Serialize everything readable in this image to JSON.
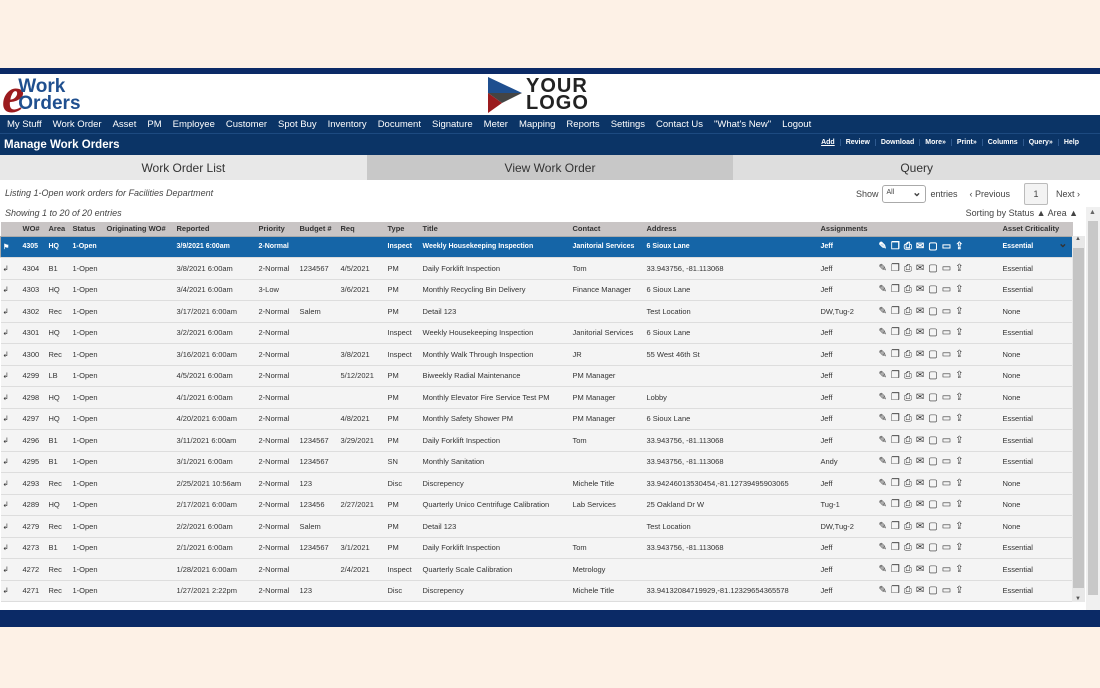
{
  "app": {
    "logo_text": "eWork Orders",
    "brand_logo": "YOUR LOGO",
    "colors": {
      "nav": "#0b3466",
      "selected_row": "#1565a7",
      "logo_red": "#9b1b1e"
    }
  },
  "nav": [
    "My Stuff",
    "Work Order",
    "Asset",
    "PM",
    "Employee",
    "Customer",
    "Spot Buy",
    "Inventory",
    "Document",
    "Signature",
    "Meter",
    "Mapping",
    "Reports",
    "Settings",
    "Contact Us",
    "\"What's New\"",
    "Logout"
  ],
  "title": "Manage Work Orders",
  "toolbar": [
    "Add",
    "Review",
    "Download",
    "More»",
    "Print»",
    "Columns",
    "Query»",
    "Help"
  ],
  "tabs": [
    "Work Order List",
    "View Work Order",
    "Query"
  ],
  "listing": "Listing 1-Open work orders for Facilities Department",
  "showing": "Showing 1 to 20 of 20 entries",
  "pager": {
    "show": "Show",
    "select": "All",
    "entries": "entries",
    "prev": "‹ Previous",
    "page": "1",
    "next": "Next ›"
  },
  "sorting": "Sorting by Status ▲ Area ▲",
  "columns": [
    "",
    "WO#",
    "Area",
    "Status",
    "Originating WO#",
    "Reported",
    "Priority",
    "Budget #",
    "Req",
    "Type",
    "Title",
    "Contact",
    "Address",
    "Assignments",
    "",
    "Asset Criticality"
  ],
  "row_icons": [
    "pencil-icon",
    "copy-icon",
    "print-icon",
    "email-icon",
    "note-icon",
    "comment-icon",
    "upload-icon"
  ],
  "rows": [
    [
      "4305",
      "HQ",
      "1-Open",
      "",
      "3/9/2021 6:00am",
      "2-Normal",
      "",
      "",
      "Inspect",
      "Weekly Housekeeping Inspection",
      "Janitorial Services",
      "6 Sioux Lane",
      "Jeff",
      "Essential"
    ],
    [
      "4304",
      "B1",
      "1-Open",
      "",
      "3/8/2021 6:00am",
      "2-Normal",
      "1234567",
      "4/5/2021",
      "PM",
      "Daily Forklift Inspection",
      "Tom",
      "33.943756, -81.113068",
      "Jeff",
      "Essential"
    ],
    [
      "4303",
      "HQ",
      "1-Open",
      "",
      "3/4/2021 6:00am",
      "3-Low",
      "",
      "3/6/2021",
      "PM",
      "Monthly Recycling Bin Delivery",
      "Finance Manager",
      "6 Sioux Lane",
      "Jeff",
      "Essential"
    ],
    [
      "4302",
      "Rec",
      "1-Open",
      "",
      "3/17/2021 6:00am",
      "2-Normal",
      "Salem",
      "",
      "PM",
      "Detail 123",
      "",
      "Test Location",
      "DW,Tug-2",
      "None"
    ],
    [
      "4301",
      "HQ",
      "1-Open",
      "",
      "3/2/2021 6:00am",
      "2-Normal",
      "",
      "",
      "Inspect",
      "Weekly Housekeeping Inspection",
      "Janitorial Services",
      "6 Sioux Lane",
      "Jeff",
      "Essential"
    ],
    [
      "4300",
      "Rec",
      "1-Open",
      "",
      "3/16/2021 6:00am",
      "2-Normal",
      "",
      "3/8/2021",
      "Inspect",
      "Monthly Walk Through Inspection",
      "JR",
      "55 West 46th St",
      "Jeff",
      "None"
    ],
    [
      "4299",
      "LB",
      "1-Open",
      "",
      "4/5/2021 6:00am",
      "2-Normal",
      "",
      "5/12/2021",
      "PM",
      "Biweekly Radial Maintenance",
      "PM Manager",
      "",
      "Jeff",
      "None"
    ],
    [
      "4298",
      "HQ",
      "1-Open",
      "",
      "4/1/2021 6:00am",
      "2-Normal",
      "",
      "",
      "PM",
      "Monthly Elevator Fire Service Test PM",
      "PM Manager",
      "Lobby",
      "Jeff",
      "None"
    ],
    [
      "4297",
      "HQ",
      "1-Open",
      "",
      "4/20/2021 6:00am",
      "2-Normal",
      "",
      "4/8/2021",
      "PM",
      "Monthly Safety Shower PM",
      "PM Manager",
      "6 Sioux Lane",
      "Jeff",
      "Essential"
    ],
    [
      "4296",
      "B1",
      "1-Open",
      "",
      "3/11/2021 6:00am",
      "2-Normal",
      "1234567",
      "3/29/2021",
      "PM",
      "Daily Forklift Inspection",
      "Tom",
      "33.943756, -81.113068",
      "Jeff",
      "Essential"
    ],
    [
      "4295",
      "B1",
      "1-Open",
      "",
      "3/1/2021 6:00am",
      "2-Normal",
      "1234567",
      "",
      "SN",
      "Monthly Sanitation",
      "",
      "33.943756, -81.113068",
      "Andy",
      "Essential"
    ],
    [
      "4293",
      "Rec",
      "1-Open",
      "",
      "2/25/2021 10:56am",
      "2-Normal",
      "123",
      "",
      "Disc",
      "Discrepency",
      "Michele Title",
      "33.94246013530454,-81.12739495903065",
      "Jeff",
      "None"
    ],
    [
      "4289",
      "HQ",
      "1-Open",
      "",
      "2/17/2021 6:00am",
      "2-Normal",
      "123456",
      "2/27/2021",
      "PM",
      "Quarterly Unico Centrifuge Calibration",
      "Lab Services",
      "25 Oakland Dr W",
      "Tug-1",
      "None"
    ],
    [
      "4279",
      "Rec",
      "1-Open",
      "",
      "2/2/2021 6:00am",
      "2-Normal",
      "Salem",
      "",
      "PM",
      "Detail 123",
      "",
      "Test Location",
      "DW,Tug-2",
      "None"
    ],
    [
      "4273",
      "B1",
      "1-Open",
      "",
      "2/1/2021 6:00am",
      "2-Normal",
      "1234567",
      "3/1/2021",
      "PM",
      "Daily Forklift Inspection",
      "Tom",
      "33.943756, -81.113068",
      "Jeff",
      "Essential"
    ],
    [
      "4272",
      "Rec",
      "1-Open",
      "",
      "1/28/2021 6:00am",
      "2-Normal",
      "",
      "2/4/2021",
      "Inspect",
      "Quarterly Scale Calibration",
      "Metrology",
      "",
      "Jeff",
      "Essential"
    ],
    [
      "4271",
      "Rec",
      "1-Open",
      "",
      "1/27/2021 2:22pm",
      "2-Normal",
      "123",
      "",
      "Disc",
      "Discrepency",
      "Michele Title",
      "33.94132084719929,-81.12329654365578",
      "Jeff",
      "Essential"
    ]
  ]
}
